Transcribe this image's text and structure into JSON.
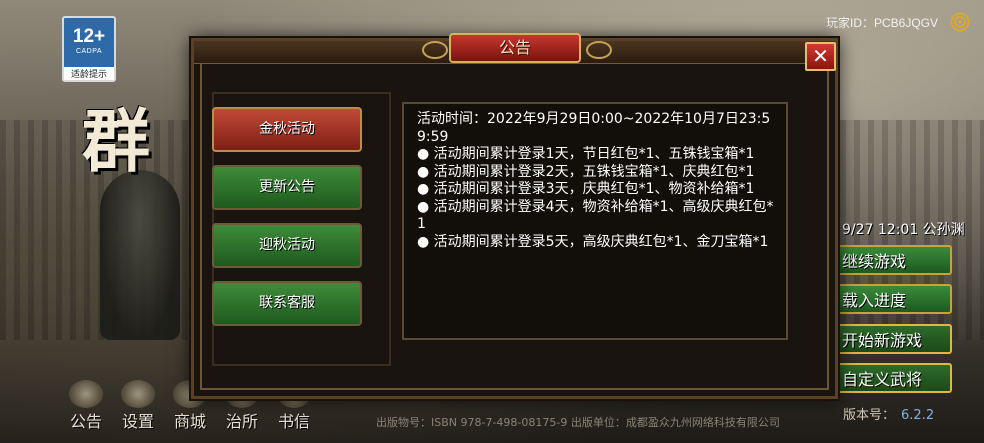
{
  "age_rating": {
    "age": "12+",
    "org": "CADPA",
    "hint": "适龄提示"
  },
  "player_id": "玩家ID：PCB6JQGV",
  "game_title_glyph": "群",
  "save_info": "9/27 12:01 公孙渊",
  "main_menu": [
    "继续游戏",
    "载入进度",
    "开始新游戏",
    "自定义武将"
  ],
  "bottom_nav": [
    "公告",
    "设置",
    "商城",
    "治所",
    "书信"
  ],
  "footer": "出版物号：ISBN 978-7-498-08175-9   出版单位：成都盈众九州网络科技有限公司",
  "version": {
    "label": "版本号：",
    "number": "6.2.2"
  },
  "modal": {
    "title": "公告",
    "close": "✕",
    "tabs": [
      {
        "label": "金秋活动",
        "active": true
      },
      {
        "label": "更新公告",
        "active": false
      },
      {
        "label": "迎秋活动",
        "active": false
      },
      {
        "label": "联系客服",
        "active": false
      }
    ],
    "content": {
      "time": "活动时间：2022年9月29日0:00~2022年10月7日23:59:59",
      "items": [
        "● 活动期间累计登录1天，节日红包*1、五铢钱宝箱*1",
        "● 活动期间累计登录2天，五铢钱宝箱*1、庆典红包*1",
        "● 活动期间累计登录3天，庆典红包*1、物资补给箱*1",
        "● 活动期间累计登录4天，物资补给箱*1、高级庆典红包*1",
        "● 活动期间累计登录5天，高级庆典红包*1、金刀宝箱*1"
      ]
    }
  },
  "colors": {
    "accent_red": "#c24a38",
    "accent_green": "#3f8c3a",
    "gold": "#d9b15a",
    "version_blue": "#7fb2e8"
  }
}
